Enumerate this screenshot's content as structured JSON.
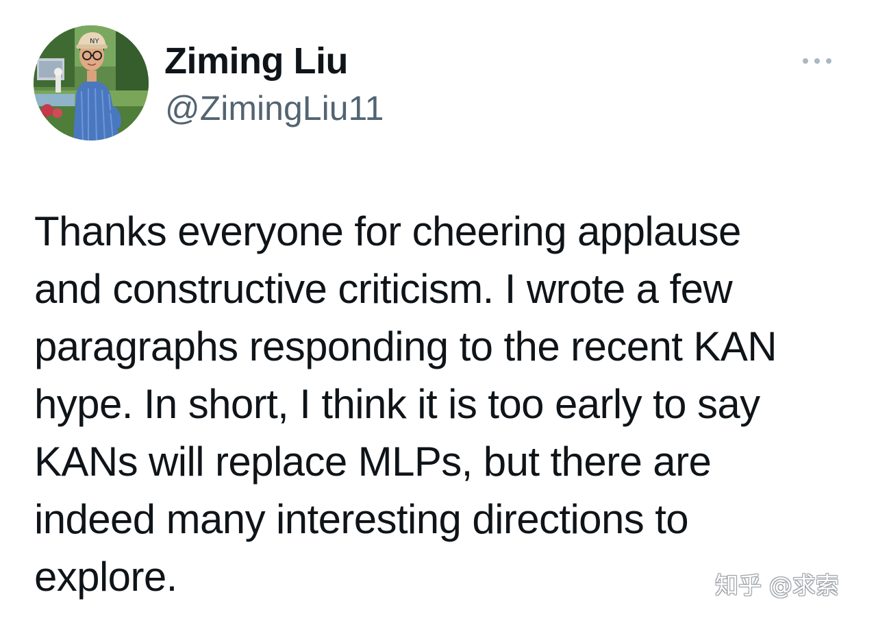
{
  "tweet": {
    "author": {
      "display_name": "Ziming Liu",
      "handle": "@ZimingLiu11",
      "avatar_icon": "profile-photo"
    },
    "more_icon": "more-horizontal-icon",
    "text": "Thanks everyone for cheering applause\nand constructive criticism. I wrote a few\nparagraphs responding to the recent KAN\nhype. In short, I think it is too early to say\nKANs will replace MLPs, but there are\nindeed many interesting directions to\nexplore."
  },
  "watermark": {
    "text": "知乎 @求索"
  },
  "colors": {
    "text_primary": "#0f1419",
    "text_secondary": "#536471",
    "more_icon": "#aab8c2",
    "background": "#ffffff"
  }
}
